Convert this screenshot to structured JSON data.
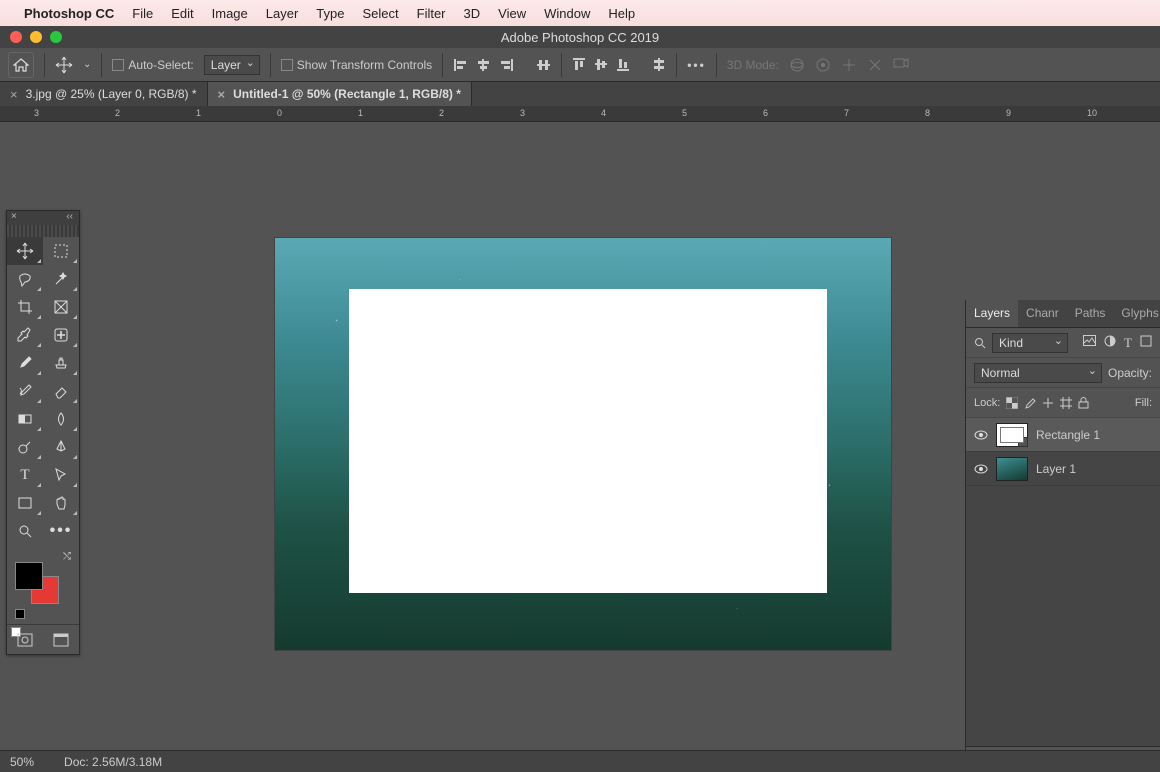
{
  "menubar": {
    "app_name": "Photoshop CC",
    "items": [
      "File",
      "Edit",
      "Image",
      "Layer",
      "Type",
      "Select",
      "Filter",
      "3D",
      "View",
      "Window",
      "Help"
    ]
  },
  "window": {
    "title": "Adobe Photoshop CC 2019"
  },
  "optionsbar": {
    "auto_select_label": "Auto-Select:",
    "auto_select_scope": "Layer",
    "show_transform_label": "Show Transform Controls",
    "mode3d_label": "3D Mode:"
  },
  "doc_tabs": [
    {
      "label": "3.jpg @ 25% (Layer 0, RGB/8) *",
      "active": false
    },
    {
      "label": "Untitled-1 @ 50% (Rectangle 1, RGB/8) *",
      "active": true
    }
  ],
  "ruler": {
    "ticks": [
      "3",
      "2",
      "1",
      "0",
      "1",
      "2",
      "3",
      "4",
      "5",
      "6",
      "7",
      "8",
      "9",
      "10"
    ]
  },
  "tools": {
    "list": [
      "move-tool",
      "marquee-tool",
      "lasso-tool",
      "magic-wand-tool",
      "crop-tool",
      "frame-tool",
      "eyedropper-tool",
      "healing-brush-tool",
      "brush-tool",
      "clone-stamp-tool",
      "history-brush-tool",
      "eraser-tool",
      "gradient-tool",
      "blur-tool",
      "dodge-tool",
      "pen-tool",
      "type-tool",
      "path-selection-tool",
      "rectangle-tool",
      "hand-tool",
      "zoom-tool",
      "edit-toolbar"
    ],
    "selected": "move-tool",
    "fg_color": "#000000",
    "bg_color": "#e53935"
  },
  "layers_panel": {
    "tabs": [
      "Layers",
      "Channels",
      "Paths",
      "Glyphs"
    ],
    "tabs_display": [
      "Layers",
      "Chanr",
      "Paths",
      "Glyphs"
    ],
    "active_tab": "Layers",
    "filter_kind_label": "Kind",
    "blend_mode": "Normal",
    "opacity_label": "Opacity:",
    "lock_label": "Lock:",
    "fill_label": "Fill:",
    "layers": [
      {
        "name": "Rectangle 1",
        "visible": true,
        "selected": true,
        "kind": "shape"
      },
      {
        "name": "Layer 1",
        "visible": true,
        "selected": false,
        "kind": "pixel"
      }
    ]
  },
  "statusbar": {
    "zoom": "50%",
    "doc_label": "Doc: 2.56M/3.18M"
  }
}
